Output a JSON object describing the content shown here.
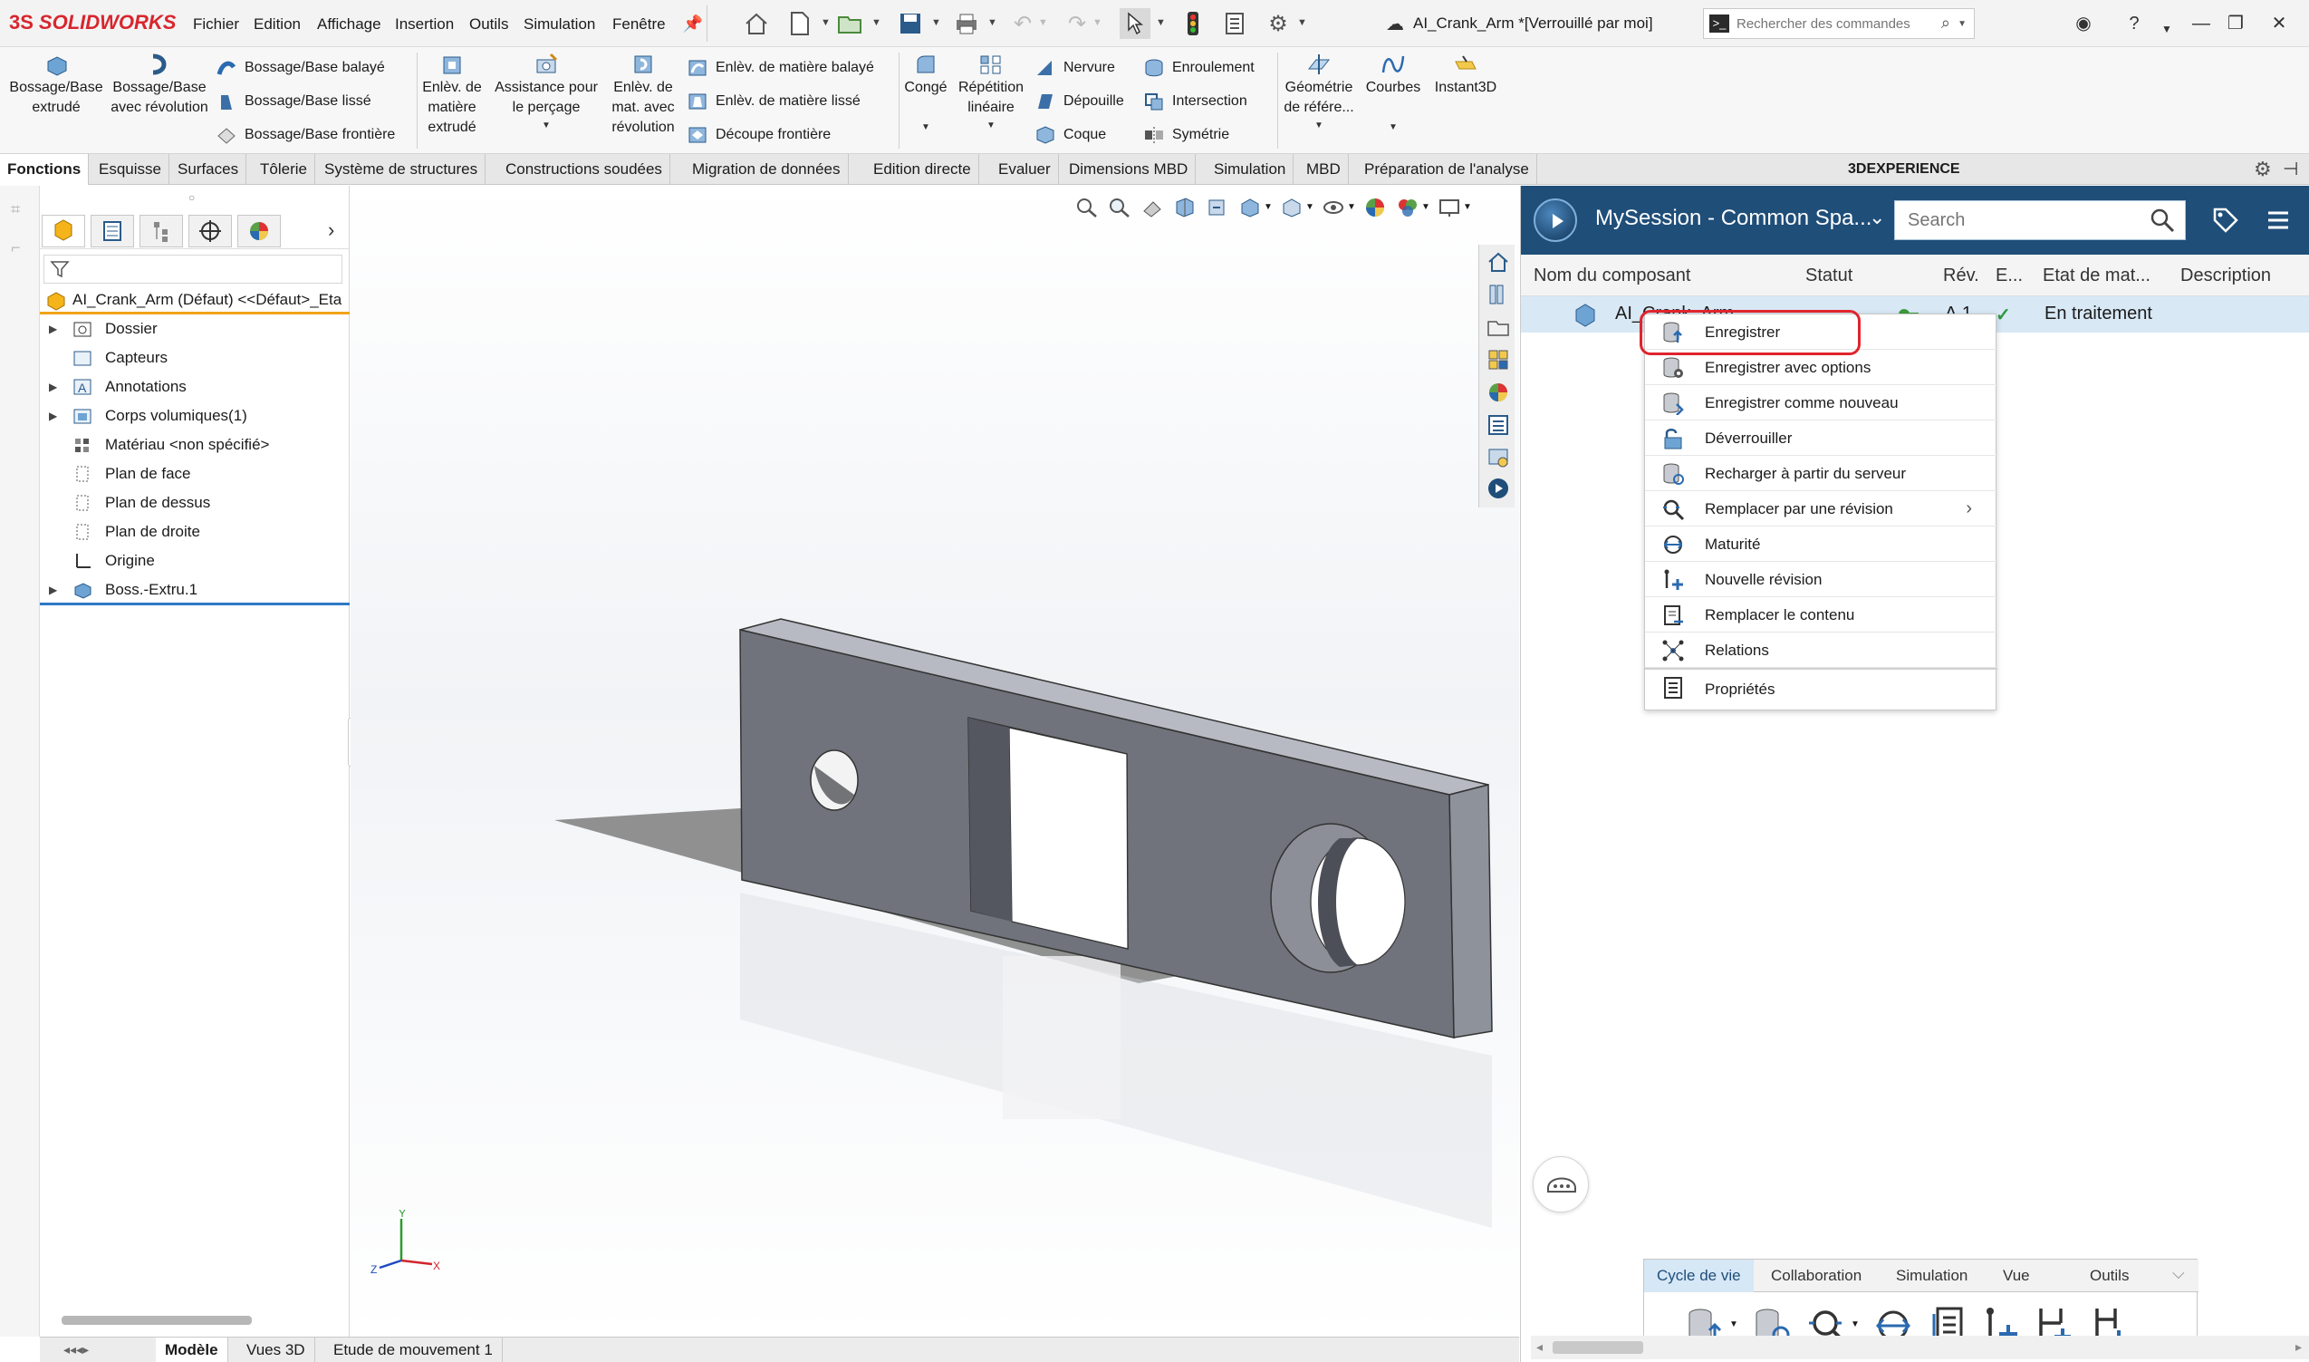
{
  "app": {
    "logo_ds": "3S",
    "logo_name": "SOLIDWORKS",
    "menu": [
      "Fichier",
      "Edition",
      "Affichage",
      "Insertion",
      "Outils",
      "Simulation",
      "Fenêtre"
    ],
    "document_title": "AI_Crank_Arm *[Verrouillé par moi]",
    "search_placeholder": "Rechercher des commandes"
  },
  "ribbon": {
    "big_buttons": [
      {
        "label": "Bossage/Base extrudé"
      },
      {
        "label": "Bossage/Base avec révolution"
      },
      {
        "label": "Enlèv. de matière extrudé"
      },
      {
        "label": "Assistance pour le perçage"
      },
      {
        "label": "Enlèv. de mat. avec révolution"
      },
      {
        "label": "Congé"
      },
      {
        "label": "Répétition linéaire"
      },
      {
        "label": "Géométrie de référe..."
      },
      {
        "label": "Courbes"
      },
      {
        "label": "Instant3D"
      }
    ],
    "small_buttons": [
      {
        "label": "Bossage/Base balayé"
      },
      {
        "label": "Bossage/Base lissé"
      },
      {
        "label": "Bossage/Base frontière"
      },
      {
        "label": "Enlèv. de matière balayé"
      },
      {
        "label": "Enlèv. de matière lissé"
      },
      {
        "label": "Découpe frontière"
      },
      {
        "label": "Nervure"
      },
      {
        "label": "Dépouille"
      },
      {
        "label": "Coque"
      },
      {
        "label": "Enroulement"
      },
      {
        "label": "Intersection"
      },
      {
        "label": "Symétrie"
      }
    ]
  },
  "tabs": [
    "Fonctions",
    "Esquisse",
    "Surfaces",
    "Tôlerie",
    "Système de structures",
    "Constructions soudées",
    "Migration de données",
    "Edition directe",
    "Evaluer",
    "Dimensions MBD",
    "Simulation",
    "MBD",
    "Préparation de l'analyse"
  ],
  "tab_3dx": "3DEXPERIENCE",
  "feature_tree": {
    "root": "AI_Crank_Arm (Défaut) <<Défaut>_Eta",
    "items": [
      {
        "label": "Dossier",
        "icon": "folder-icon"
      },
      {
        "label": "Capteurs",
        "icon": "sensor-icon"
      },
      {
        "label": "Annotations",
        "icon": "annotation-icon"
      },
      {
        "label": "Corps volumiques(1)",
        "icon": "solid-bodies-icon"
      },
      {
        "label": "Matériau <non spécifié>",
        "icon": "material-icon"
      },
      {
        "label": "Plan de face",
        "icon": "plane-icon"
      },
      {
        "label": "Plan de dessus",
        "icon": "plane-icon"
      },
      {
        "label": "Plan de droite",
        "icon": "plane-icon"
      },
      {
        "label": "Origine",
        "icon": "origin-icon"
      },
      {
        "label": "Boss.-Extru.1",
        "icon": "extrude-icon"
      }
    ]
  },
  "triad": {
    "x": "X",
    "y": "Y",
    "z": "Z"
  },
  "xp_panel": {
    "session": "MySession - Common Spa...",
    "search_placeholder": "Search",
    "columns": [
      "Nom du composant",
      "Statut",
      "Rév.",
      "E...",
      "Etat de mat...",
      "Description"
    ],
    "row": {
      "name": "AI_Crank_Arm",
      "revision": "A.1",
      "maturity": "En traitement"
    }
  },
  "context_menu": [
    {
      "label": "Enregistrer",
      "icon": "save-db-icon"
    },
    {
      "label": "Enregistrer avec options",
      "icon": "save-options-icon"
    },
    {
      "label": "Enregistrer comme nouveau",
      "icon": "save-new-icon"
    },
    {
      "label": "Déverrouiller",
      "icon": "unlock-icon"
    },
    {
      "label": "Recharger à partir du serveur",
      "icon": "reload-icon"
    },
    {
      "label": "Remplacer par une révision",
      "icon": "replace-revision-icon",
      "submenu": true
    },
    {
      "label": "Maturité",
      "icon": "maturity-icon"
    },
    {
      "label": "Nouvelle révision",
      "icon": "new-revision-icon"
    },
    {
      "label": "Remplacer le contenu",
      "icon": "replace-content-icon"
    },
    {
      "label": "Relations",
      "icon": "relations-icon"
    },
    {
      "label": "Propriétés",
      "icon": "properties-icon"
    }
  ],
  "action_bar": {
    "tabs": [
      "Cycle de vie",
      "Collaboration",
      "Simulation",
      "Vue",
      "Outils"
    ]
  },
  "bottom_tabs": [
    "Modèle",
    "Vues 3D",
    "Etude de mouvement 1"
  ],
  "colors": {
    "accent": "#1f4e79",
    "highlight": "#e0242d",
    "brand": "#d8262e",
    "row_selected": "#d8e8f5"
  }
}
